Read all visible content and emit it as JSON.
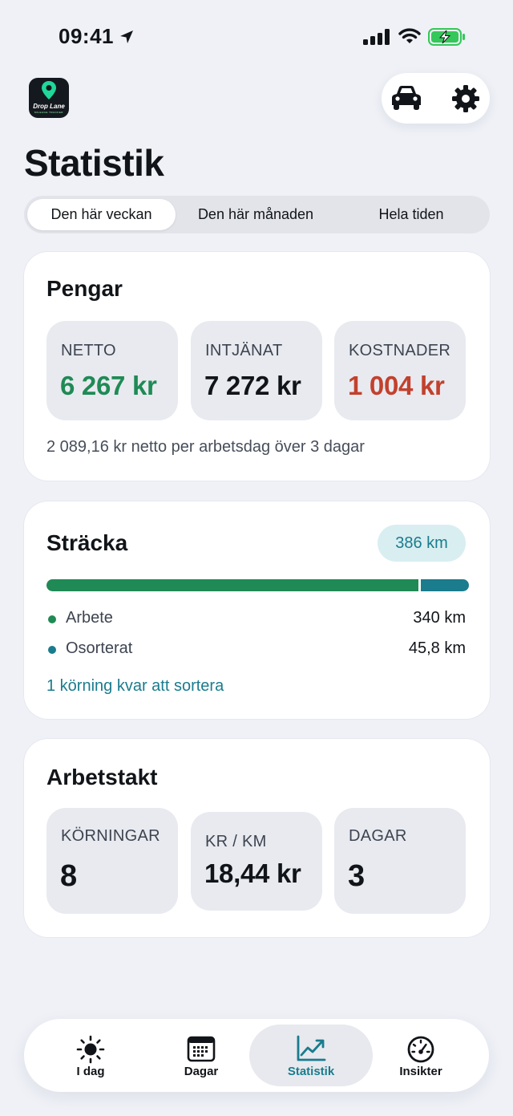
{
  "status_bar": {
    "time": "09:41"
  },
  "app": {
    "logo_text": "Drop Lane",
    "logo_subtext": "MILEAGE TRACKER"
  },
  "page": {
    "title": "Statistik"
  },
  "period_tabs": [
    "Den här veckan",
    "Den här månaden",
    "Hela tiden"
  ],
  "active_period": 0,
  "money": {
    "title": "Pengar",
    "netto_label": "NETTO",
    "netto_value": "6 267 kr",
    "earned_label": "INTJÄNAT",
    "earned_value": "7 272 kr",
    "costs_label": "KOSTNADER",
    "costs_value": "1 004 kr",
    "footnote": "2 089,16 kr netto per arbetsdag över 3 dagar"
  },
  "distance": {
    "title": "Sträcka",
    "total_badge": "386 km",
    "work_fraction": 0.881,
    "work_label": "Arbete",
    "work_value": "340 km",
    "unsorted_label": "Osorterat",
    "unsorted_value": "45,8 km",
    "sort_link": "1 körning kvar att sortera"
  },
  "pace": {
    "title": "Arbetstakt",
    "runs_label": "KÖRNINGAR",
    "runs_value": "8",
    "krkm_label": "KR / KM",
    "krkm_value": "18,44 kr",
    "days_label": "DAGAR",
    "days_value": "3"
  },
  "tab_bar": {
    "today": "I dag",
    "days": "Dagar",
    "stats": "Statistik",
    "insights": "Insikter"
  },
  "colors": {
    "positive": "#1f8a55",
    "negative": "#c2412d",
    "accent": "#1a7c8d"
  },
  "icons": {
    "header": [
      "car-icon",
      "gear-icon"
    ],
    "tabs": [
      "sun-icon",
      "calendar-icon",
      "chart-icon",
      "speedometer-icon"
    ]
  }
}
